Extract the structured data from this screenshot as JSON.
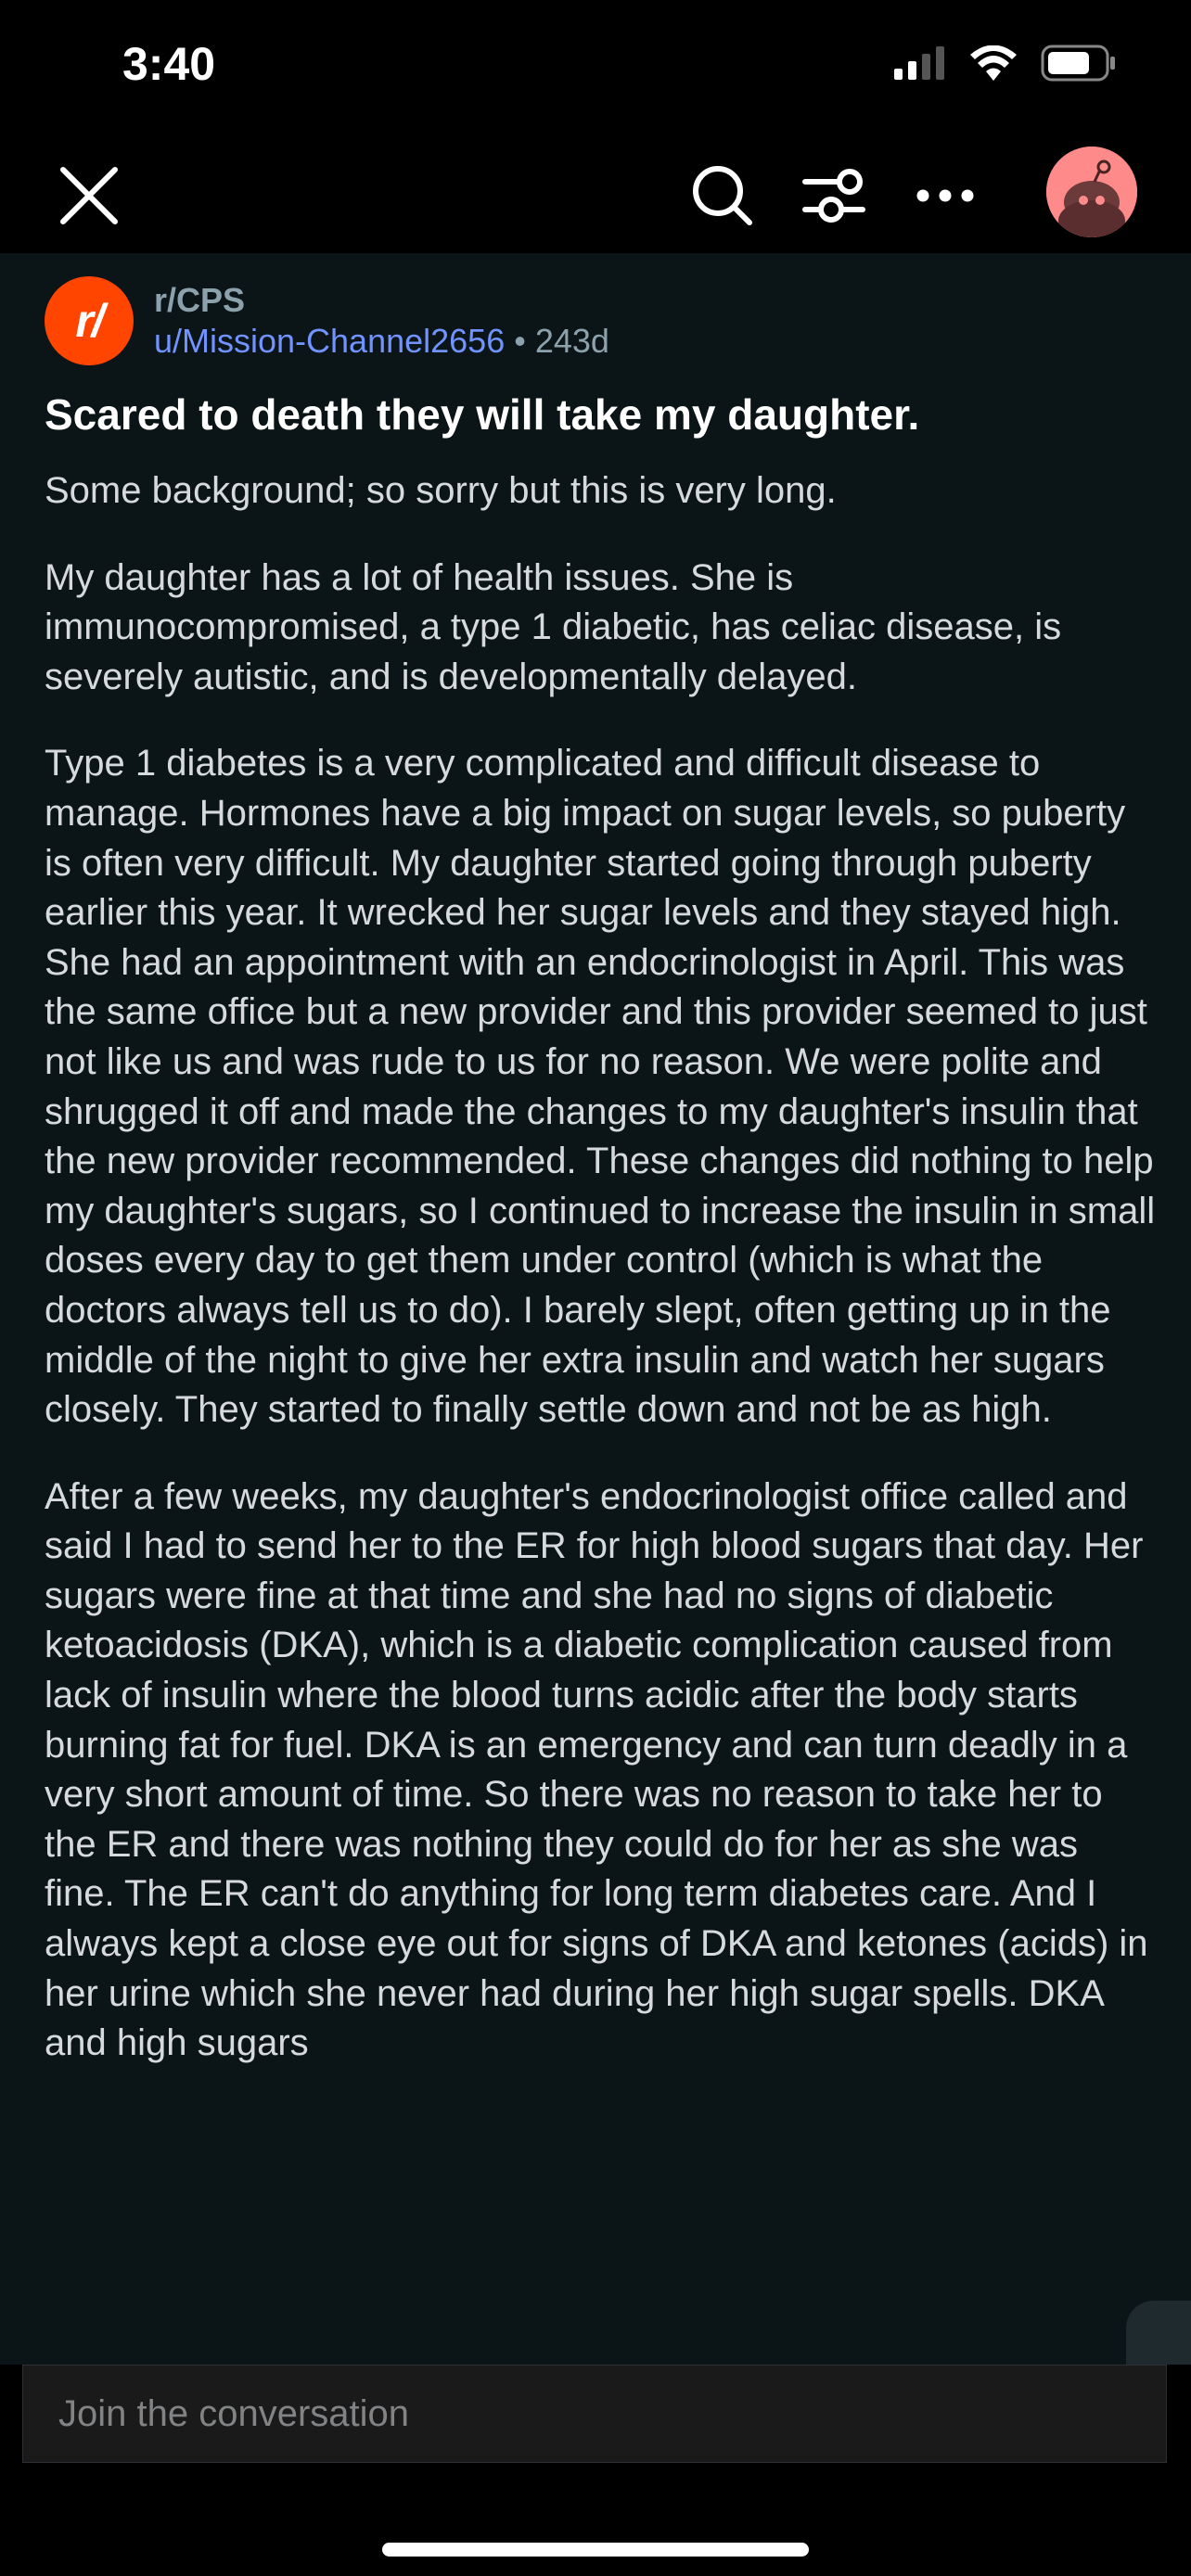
{
  "status": {
    "time": "3:40"
  },
  "post": {
    "subreddit": "r/CPS",
    "author": "u/Mission-Channel2656",
    "separator": "•",
    "age": "243d",
    "title": "Scared to death they will take my daughter.",
    "paragraphs": [
      "Some background; so sorry but this is very long.",
      "My daughter has a lot of health issues. She is immunocompromised, a type 1 diabetic, has celiac disease, is severely autistic, and is developmentally delayed.",
      "Type 1 diabetes is a very complicated and difficult disease to manage. Hormones have a big impact on sugar levels, so puberty is often very difficult. My daughter started going through puberty earlier this year. It wrecked her sugar levels and they stayed high. She had an appointment with an endocrinologist in April. This was the same office but a new provider and this provider seemed to just not like us and was rude to us for no reason. We were polite and shrugged it off and made the changes to my daughter's insulin that the new provider recommended. These changes did nothing to help my daughter's sugars, so I continued to increase the insulin in small doses every day to get them under control (which is what the doctors always tell us to do). I barely slept, often getting up in the middle of the night to give her extra insulin and watch her sugars closely. They started to finally settle down and not be as high.",
      "After a few weeks, my daughter's endocrinologist office called and said I had to send her to the ER for high blood sugars that day. Her sugars were fine at that time and she had no signs of diabetic ketoacidosis (DKA), which is a diabetic complication caused from lack of insulin where the blood turns acidic after the body starts burning fat for fuel. DKA is an emergency and can turn deadly in a very short amount of time. So there was no reason to take her to the ER and there was nothing they could do for her as she was fine. The ER can't do anything for long term diabetes care. And I always kept a close eye out for signs of DKA and ketones (acids) in her urine which she never had during her high sugar spells. DKA and high sugars"
    ]
  },
  "composer": {
    "placeholder": "Join the conversation"
  },
  "icons": {
    "close": "close-icon",
    "search": "search-icon",
    "sort": "sort-options-icon",
    "more": "more-icon",
    "avatar": "snoo-avatar",
    "subreddit": "subreddit-icon",
    "side_tab": "chevron-left-icon",
    "scroll_down": "chevron-down-icon"
  },
  "colors": {
    "background": "#0b1416",
    "author": "#7193ff",
    "subreddit_icon": "#ff4500",
    "avatar_bg": "#ff8a8a"
  }
}
